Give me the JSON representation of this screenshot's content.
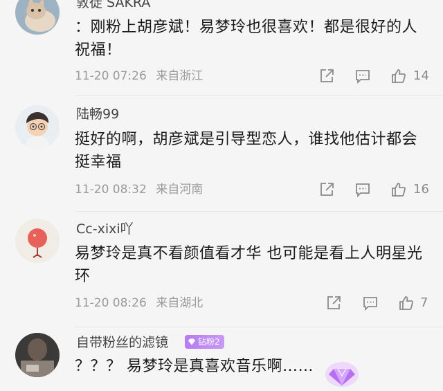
{
  "comments": [
    {
      "username": "敦徒 SAKRA",
      "text": "：刚粉上胡彦斌！易梦玲也很喜欢！都是很好的人祝福！",
      "time": "11-20 07:26",
      "location": "来自浙江",
      "likes": "14"
    },
    {
      "username": "陆畅99",
      "text": "挺好的啊，胡彦斌是引导型恋人，谁找他估计都会挺幸福",
      "time": "11-20 08:32",
      "location": "来自河南",
      "likes": "16"
    },
    {
      "username": "Cc-xixi吖",
      "text": "易梦玲是真不看颜值看才华 也可能是看上人明星光环",
      "time": "11-20 08:26",
      "location": "来自湖北",
      "likes": "7"
    },
    {
      "username": "自带粉丝的滤镜",
      "badge": "钻粉2",
      "text": "？？？ 易梦玲是真喜欢音乐啊……"
    }
  ],
  "icons": {
    "share": "share-icon",
    "comment": "comment-icon",
    "like": "thumbs-up-icon",
    "badge": "diamond-icon"
  },
  "colors": {
    "background": "#f5f5f5",
    "text": "#1a1a1a",
    "meta": "#9a9a9a",
    "badge": "#b57bf0"
  }
}
